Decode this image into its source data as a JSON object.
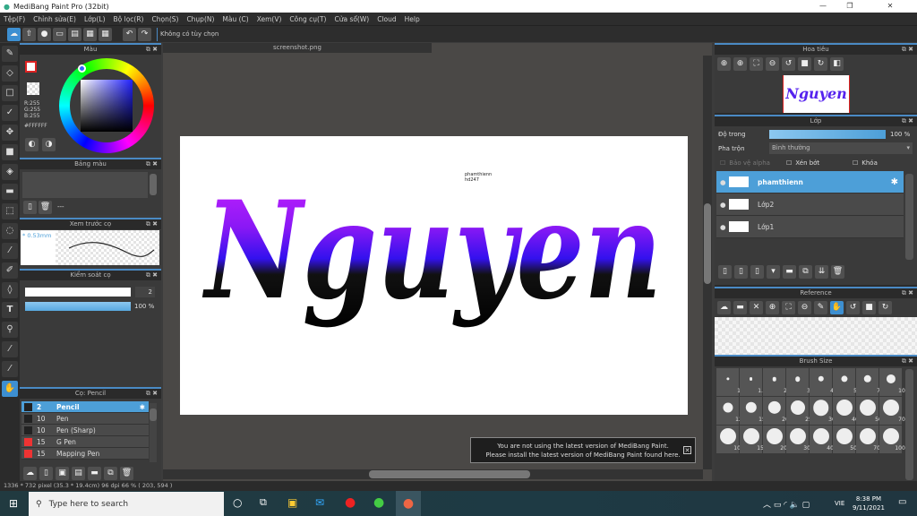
{
  "window": {
    "title": "MediBang Paint Pro (32bit)",
    "min": "—",
    "max": "❐",
    "close": "✕"
  },
  "menu": [
    "Tệp(F)",
    "Chỉnh sửa(E)",
    "Lớp(L)",
    "Bộ lọc(R)",
    "Chọn(S)",
    "Chụp(N)",
    "Màu (C)",
    "Xem(V)",
    "Công cụ(T)",
    "Cửa sổ(W)",
    "Cloud",
    "Help"
  ],
  "toolbar": {
    "option_text": "Không có tùy chọn"
  },
  "document": {
    "tab": "screenshot.png",
    "artwork_text": "Nguyen",
    "caption_line1": "phamthienn",
    "caption_line2": "hd247"
  },
  "color_panel": {
    "title": "Màu",
    "r": "R:255",
    "g": "G:255",
    "b": "B:255",
    "hex": "#FFFFFF"
  },
  "palette_panel": {
    "title": "Bảng màu",
    "name": "---"
  },
  "brush_preview": {
    "title": "Xem trước cọ",
    "size": "* 0.53mm"
  },
  "brush_control": {
    "title": "Kiểm soát cọ",
    "size": "2",
    "opacity": "100 %",
    "opacity_value": 100
  },
  "brush_panel": {
    "title": "Cọ: Pencil",
    "items": [
      {
        "size": "2",
        "name": "Pencil",
        "color": "#222222",
        "selected": true
      },
      {
        "size": "10",
        "name": "Pen",
        "color": "#222222"
      },
      {
        "size": "10",
        "name": "Pen (Sharp)",
        "color": "#222222"
      },
      {
        "size": "15",
        "name": "G Pen",
        "color": "#ee3333"
      },
      {
        "size": "15",
        "name": "Mapping Pen",
        "color": "#ee3333"
      }
    ]
  },
  "navigator": {
    "title": "Hoa tiêu"
  },
  "layer_panel": {
    "title": "Lớp",
    "opacity_label": "Độ trong",
    "opacity": "100 %",
    "opacity_value": 100,
    "blend_label": "Pha trộn",
    "blend": "Bình thường",
    "protect_alpha": "Bảo vệ alpha",
    "clipping": "Xén bớt",
    "lock": "Khóa",
    "layers": [
      {
        "name": "phamthienn",
        "selected": true
      },
      {
        "name": "Lớp2"
      },
      {
        "name": "Lớp1"
      }
    ]
  },
  "reference": {
    "title": "Reference"
  },
  "brush_size": {
    "title": "Brush Size",
    "sizes": [
      "1",
      "1.5",
      "2",
      "3",
      "4",
      "5",
      "7",
      "10",
      "12",
      "15",
      "20",
      "25",
      "30",
      "40",
      "50",
      "70",
      "100",
      "150",
      "200",
      "300",
      "400",
      "500",
      "700",
      "1000"
    ]
  },
  "notification": {
    "line1": "You are not using the latest version of MediBang Paint.",
    "line2": "Please install the latest version of MediBang Paint found here."
  },
  "status": "1336 * 732 pixel   (35.3 * 19.4cm)   96 dpi   66 %   ( 203, 594 )",
  "taskbar": {
    "search_placeholder": "Type here to search",
    "lang": "VIE",
    "time": "8:38 PM",
    "date": "9/11/2021"
  },
  "colors": {
    "accent": "#4d9fd8",
    "gradient_top": "#cc22ff",
    "gradient_mid": "#3311ee",
    "gradient_bottom": "#000000"
  }
}
